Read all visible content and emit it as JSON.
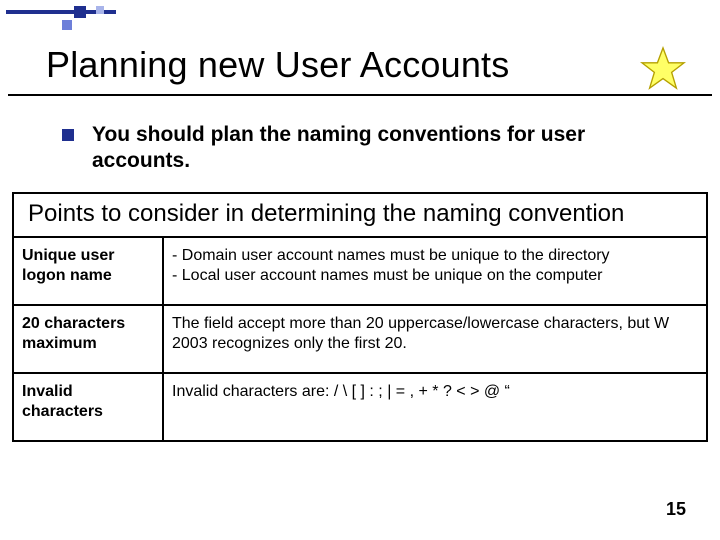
{
  "title": "Planning new User Accounts",
  "bullet": "You should plan the naming conventions for user accounts.",
  "points_header": "Points to consider in determining the naming convention",
  "rows": [
    {
      "label": "Unique user logon name",
      "text": "- Domain user account names must be unique to the directory\n- Local user account names must be unique on the computer"
    },
    {
      "label": "20 characters maximum",
      "text": "The field accept more than 20 uppercase/lowercase characters, but W 2003 recognizes only the first 20."
    },
    {
      "label": "Invalid characters",
      "text": "Invalid characters are: / \\ [ ] : ; | = , + * ? < > @ “"
    }
  ],
  "page_number": "15",
  "icons": {
    "star": "star-icon"
  }
}
